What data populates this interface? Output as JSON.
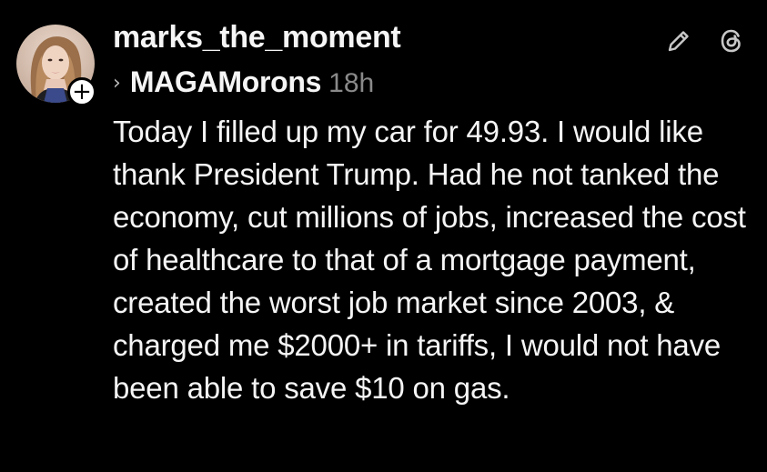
{
  "post": {
    "author": {
      "username": "marks_the_moment",
      "avatar_icon": "profile-photo",
      "follow_badge": "+"
    },
    "community": {
      "chevron": "›",
      "name": "MAGAMorons",
      "timestamp": "18h"
    },
    "actions": {
      "edit_icon": "pencil-icon",
      "app_icon": "threads-icon"
    },
    "body": "Today I filled up my car for 49.93. I would like thank President Trump. Had he not tanked the economy, cut millions of jobs, increased the cost of healthcare to that of a mortgage payment, created the worst job market since 2003, & charged me $2000+ in tariffs, I would not have been able to save $10 on gas."
  },
  "colors": {
    "background": "#000000",
    "text": "#f5f5f5",
    "timestamp": "#8a8a8a"
  }
}
